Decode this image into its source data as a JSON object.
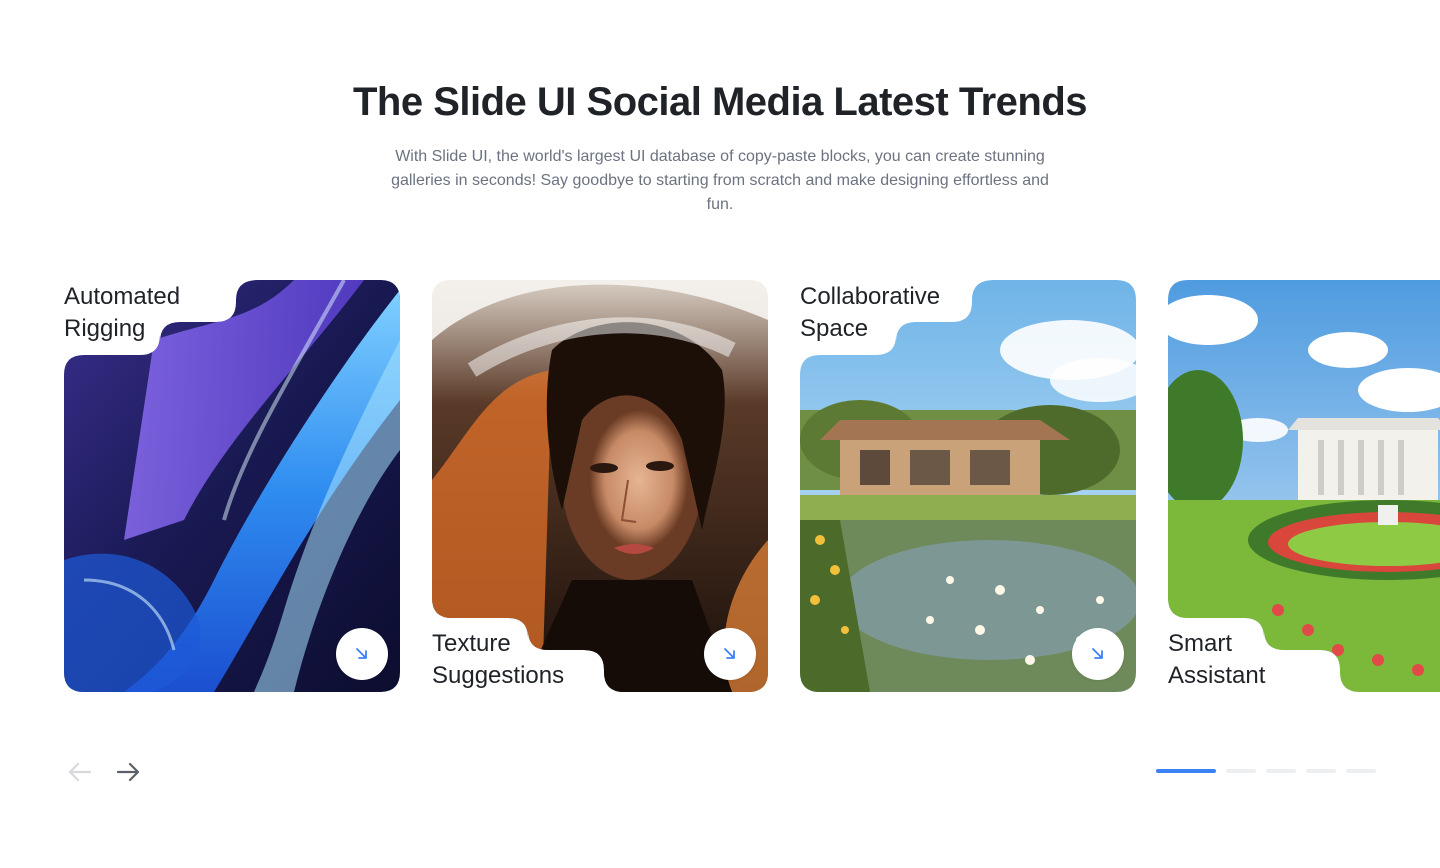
{
  "section": {
    "title": "The Slide UI Social Media Latest Trends",
    "subtitle": "With Slide UI, the world's largest UI database of copy-paste blocks, you can create stunning galleries in seconds! Say goodbye to starting from scratch and make designing effortless and fun."
  },
  "cards": [
    {
      "title": "Automated\nRigging",
      "title_position": "top-left",
      "image": "abstract blue glass waves",
      "action_icon": "arrow-down-right-icon"
    },
    {
      "title": "Texture\nSuggestions",
      "title_position": "bottom-left",
      "image": "woman portrait with flowing hair",
      "action_icon": "arrow-down-right-icon"
    },
    {
      "title": "Collaborative\nSpace",
      "title_position": "top-left",
      "image": "garden house with lily pond",
      "action_icon": "arrow-down-right-icon"
    },
    {
      "title": "Smart\nAssistant",
      "title_position": "bottom-left",
      "image": "white house with garden fountain",
      "action_icon": "arrow-down-right-icon"
    }
  ],
  "carousel": {
    "prev_icon": "arrow-left-icon",
    "next_icon": "arrow-right-icon",
    "pages": 5,
    "active_page": 1
  },
  "colors": {
    "accent": "#3b82f6",
    "heading": "#1f2328",
    "muted_text": "#6b7280",
    "dot_inactive": "#eceef1"
  }
}
